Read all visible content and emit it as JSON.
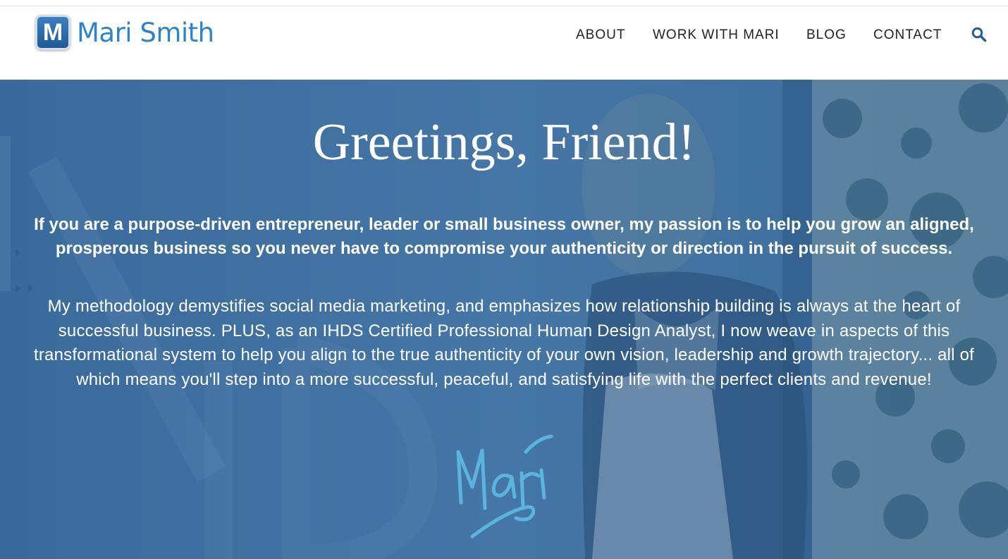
{
  "header": {
    "logo": {
      "letter": "M",
      "name": "Mari Smith"
    },
    "nav": [
      {
        "label": "ABOUT"
      },
      {
        "label": "WORK WITH MARI"
      },
      {
        "label": "BLOG"
      },
      {
        "label": "CONTACT"
      }
    ],
    "search_icon": "search-icon"
  },
  "hero": {
    "title": "Greetings, Friend!",
    "lead": "If you are a purpose-driven entrepreneur, leader or small business owner, my passion is to help you grow an aligned, prosperous business so you never have to compromise your authenticity or direction in the pursuit of success.",
    "body": "My methodology demystifies social media marketing, and emphasizes how relationship building is always at the heart of successful business. PLUS, as an IHDS Certified Professional Human Design Analyst, I now weave in aspects of this transformational system to help you align to the true authenticity of your own vision, leadership and growth trajectory... all of which means you'll step into a more successful, peaceful, and satisfying life with the perfect clients and revenue!",
    "signature": "Mari"
  },
  "colors": {
    "brand_blue": "#2d84c6",
    "hero_overlay": "#3f6f9f",
    "signature_blue": "#5bb4e0",
    "nav_text": "#222222"
  }
}
